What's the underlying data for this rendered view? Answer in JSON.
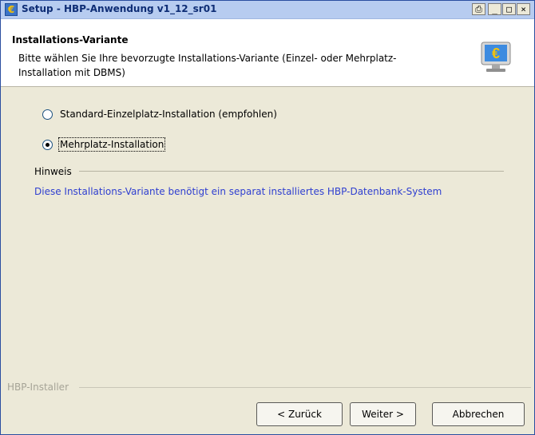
{
  "window": {
    "title": "Setup - HBP-Anwendung v1_12_sr01",
    "controls": {
      "print": "⎙",
      "minimize": "_",
      "maximize": "□",
      "close": "×"
    }
  },
  "header": {
    "title": "Installations-Variante",
    "description": "Bitte wählen Sie Ihre bevorzugte Installations-Variante (Einzel- oder Mehrplatz-Installation mit DBMS)",
    "logo_icon": "euro-monitor-icon"
  },
  "options": [
    {
      "label": "Standard-Einzelplatz-Installation (empfohlen)",
      "checked": false
    },
    {
      "label": "Mehrplatz-Installation",
      "checked": true
    }
  ],
  "hint": {
    "heading": "Hinweis",
    "text": "Diese Installations-Variante benötigt ein separat installiertes HBP-Datenbank-System"
  },
  "footer": {
    "installer_label": "HBP-Installer",
    "back_label": "< Zurück",
    "next_label": "Weiter >",
    "cancel_label": "Abbrechen"
  },
  "colors": {
    "hint_text": "#2f3fd0",
    "titlebar": "#b7ccf0",
    "dialog_bg": "#ece9d8"
  }
}
